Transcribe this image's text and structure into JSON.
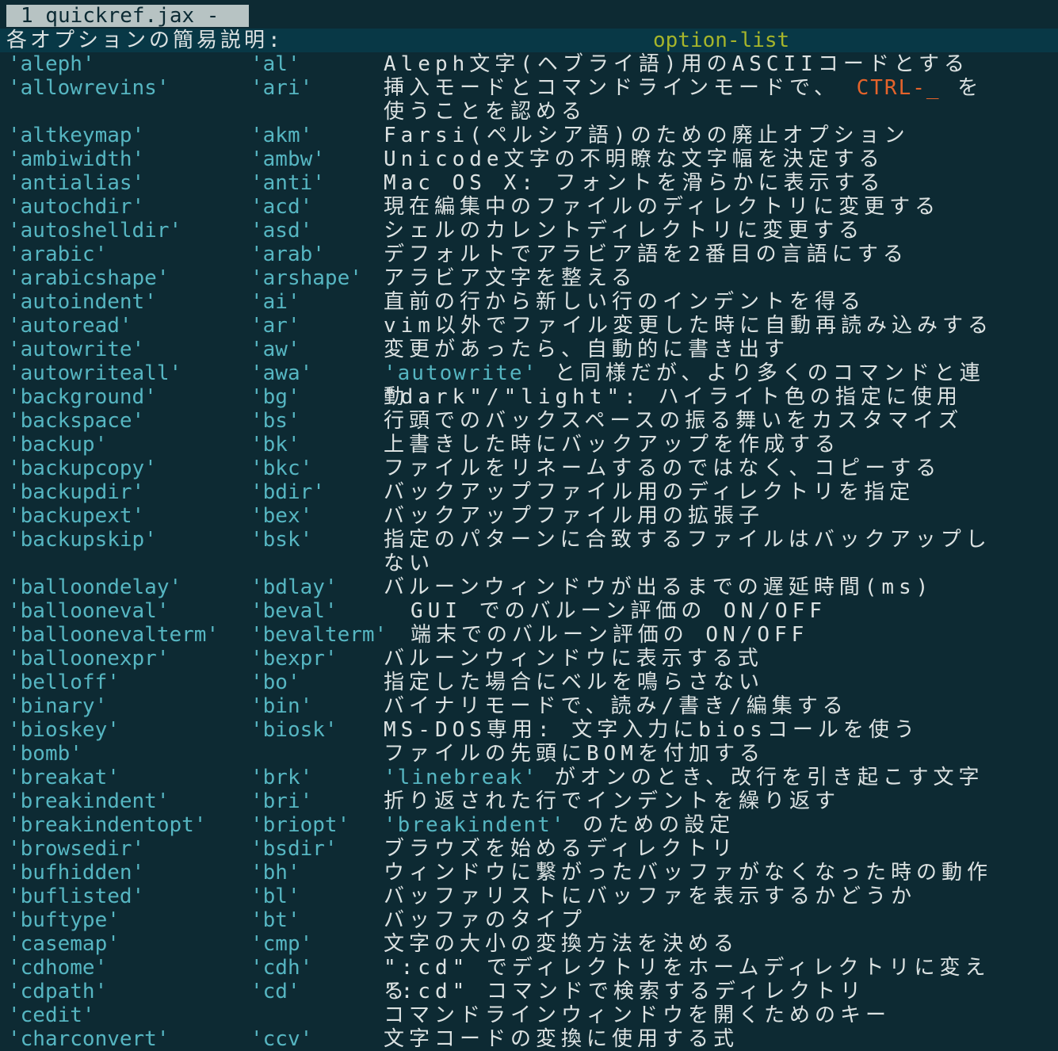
{
  "tab": {
    "label": "1 quickref.jax -"
  },
  "header": {
    "left": "各オプションの簡易説明:",
    "right": "option-list"
  },
  "options": [
    {
      "name": "'aleph'",
      "abbr": "'al'",
      "desc": "Aleph文字(ヘブライ語)用のASCIIコードとする"
    },
    {
      "name": "'allowrevins'",
      "abbr": "'ari'",
      "desc_pre": "挿入モードとコマンドラインモードで、",
      "desc_key": "CTRL-_",
      "desc_post": "を使うことを認める"
    },
    {
      "name": "'altkeymap'",
      "abbr": "'akm'",
      "desc": "Farsi(ペルシア語)のための廃止オプション"
    },
    {
      "name": "'ambiwidth'",
      "abbr": "'ambw'",
      "desc": "Unicode文字の不明瞭な文字幅を決定する"
    },
    {
      "name": "'antialias'",
      "abbr": "'anti'",
      "desc": "Mac OS X: フォントを滑らかに表示する"
    },
    {
      "name": "'autochdir'",
      "abbr": "'acd'",
      "desc": "現在編集中のファイルのディレクトリに変更する"
    },
    {
      "name": "'autoshelldir'",
      "abbr": "'asd'",
      "desc": "シェルのカレントディレクトリに変更する"
    },
    {
      "name": "'arabic'",
      "abbr": "'arab'",
      "desc": "デフォルトでアラビア語を2番目の言語にする"
    },
    {
      "name": "'arabicshape'",
      "abbr": "'arshape'",
      "desc": "アラビア文字を整える"
    },
    {
      "name": "'autoindent'",
      "abbr": "'ai'",
      "desc": "直前の行から新しい行のインデントを得る"
    },
    {
      "name": "'autoread'",
      "abbr": "'ar'",
      "desc": "vim以外でファイル変更した時に自動再読み込みする"
    },
    {
      "name": "'autowrite'",
      "abbr": "'aw'",
      "desc": "変更があったら、自動的に書き出す"
    },
    {
      "name": "'autowriteall'",
      "abbr": "'awa'",
      "desc_link": "'autowrite'",
      "desc_post": "と同様だが、より多くのコマンドと連動"
    },
    {
      "name": "'background'",
      "abbr": "'bg'",
      "desc": "\"dark\"/\"light\": ハイライト色の指定に使用"
    },
    {
      "name": "'backspace'",
      "abbr": "'bs'",
      "desc": "行頭でのバックスペースの振る舞いをカスタマイズ"
    },
    {
      "name": "'backup'",
      "abbr": "'bk'",
      "desc": "上書きした時にバックアップを作成する"
    },
    {
      "name": "'backupcopy'",
      "abbr": "'bkc'",
      "desc": "ファイルをリネームするのではなく、コピーする"
    },
    {
      "name": "'backupdir'",
      "abbr": "'bdir'",
      "desc": "バックアップファイル用のディレクトリを指定"
    },
    {
      "name": "'backupext'",
      "abbr": "'bex'",
      "desc": "バックアップファイル用の拡張子"
    },
    {
      "name": "'backupskip'",
      "abbr": "'bsk'",
      "desc": "指定のパターンに合致するファイルはバックアップしない"
    },
    {
      "name": "'balloondelay'",
      "abbr": "'bdlay'",
      "desc": "バルーンウィンドウが出るまでの遅延時間(ms)"
    },
    {
      "name": "'ballooneval'",
      "abbr": "'beval'",
      "desc": "GUI でのバルーン評価の ON/OFF"
    },
    {
      "name": "'balloonevalterm'",
      "abbr": "'bevalterm'",
      "desc": "端末でのバルーン評価の ON/OFF"
    },
    {
      "name": "'balloonexpr'",
      "abbr": "'bexpr'",
      "desc": "バルーンウィンドウに表示する式"
    },
    {
      "name": "'belloff'",
      "abbr": "'bo'",
      "desc": "指定した場合にベルを鳴らさない"
    },
    {
      "name": "'binary'",
      "abbr": "'bin'",
      "desc": "バイナリモードで、読み/書き/編集する"
    },
    {
      "name": "'bioskey'",
      "abbr": "'biosk'",
      "desc": "MS-DOS専用: 文字入力にbiosコールを使う"
    },
    {
      "name": "'bomb'",
      "abbr": "",
      "desc": "ファイルの先頭にBOMを付加する"
    },
    {
      "name": "'breakat'",
      "abbr": "'brk'",
      "desc_link": "'linebreak'",
      "desc_post": "がオンのとき、改行を引き起こす文字"
    },
    {
      "name": "'breakindent'",
      "abbr": "'bri'",
      "desc": "折り返された行でインデントを繰り返す"
    },
    {
      "name": "'breakindentopt'",
      "abbr": "'briopt'",
      "desc_link": "'breakindent'",
      "desc_post": "のための設定"
    },
    {
      "name": "'browsedir'",
      "abbr": "'bsdir'",
      "desc": "ブラウズを始めるディレクトリ"
    },
    {
      "name": "'bufhidden'",
      "abbr": "'bh'",
      "desc": "ウィンドウに繋がったバッファがなくなった時の動作"
    },
    {
      "name": "'buflisted'",
      "abbr": "'bl'",
      "desc": "バッファリストにバッファを表示するかどうか"
    },
    {
      "name": "'buftype'",
      "abbr": "'bt'",
      "desc": "バッファのタイプ"
    },
    {
      "name": "'casemap'",
      "abbr": "'cmp'",
      "desc": "文字の大小の変換方法を決める"
    },
    {
      "name": "'cdhome'",
      "abbr": "'cdh'",
      "desc": "\":cd\" でディレクトリをホームディレクトリに変える"
    },
    {
      "name": "'cdpath'",
      "abbr": "'cd'",
      "desc": "\":cd\" コマンドで検索するディレクトリ"
    },
    {
      "name": "'cedit'",
      "abbr": "",
      "desc": "コマンドラインウィンドウを開くためのキー"
    },
    {
      "name": "'charconvert'",
      "abbr": "'ccv'",
      "desc": "文字コードの変換に使用する式"
    }
  ],
  "colors": {
    "background": "#0d2a33",
    "header_background": "#083846",
    "tab_background": "#b7c3c3",
    "option_name": "#56b6c2",
    "text": "#dce2e2",
    "tag": "#a6b52b",
    "special_key": "#e4632b"
  }
}
